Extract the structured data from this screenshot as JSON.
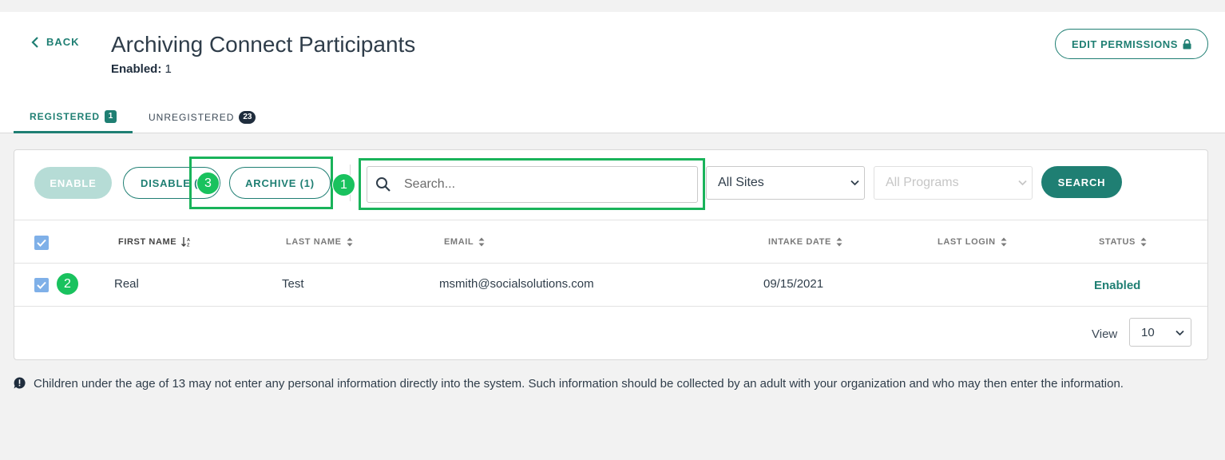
{
  "header": {
    "back_label": "BACK",
    "title": "Archiving Connect Participants",
    "enabled_label": "Enabled:",
    "enabled_count": "1",
    "edit_permissions_label": "EDIT PERMISSIONS"
  },
  "tabs": [
    {
      "label": "REGISTERED",
      "count": "1",
      "active": true
    },
    {
      "label": "UNREGISTERED",
      "count": "23",
      "active": false
    }
  ],
  "toolbar": {
    "enable_label": "ENABLE",
    "disable_label": "DISABLE (1)",
    "archive_label": "ARCHIVE (1)",
    "search_placeholder": "Search...",
    "sites_value": "All Sites",
    "programs_value": "All Programs",
    "search_button_label": "SEARCH"
  },
  "annotations": {
    "step1": "1",
    "step2": "2",
    "step3": "3"
  },
  "table": {
    "columns": [
      "FIRST NAME",
      "LAST NAME",
      "EMAIL",
      "INTAKE DATE",
      "LAST LOGIN",
      "STATUS"
    ],
    "rows": [
      {
        "first_name": "Real",
        "last_name": "Test",
        "email": "msmith@socialsolutions.com",
        "intake_date": "09/15/2021",
        "last_login": "",
        "status": "Enabled",
        "checked": true
      }
    ]
  },
  "pagination": {
    "view_label": "View",
    "page_size": "10"
  },
  "notice": "Children under the age of 13 may not enter any personal information directly into the system. Such information should be collected by an adult with your organization and who may then enter the information.",
  "colors": {
    "accent": "#1f7f73",
    "highlight": "#19b35a",
    "checkbox": "#7fb0e8"
  }
}
